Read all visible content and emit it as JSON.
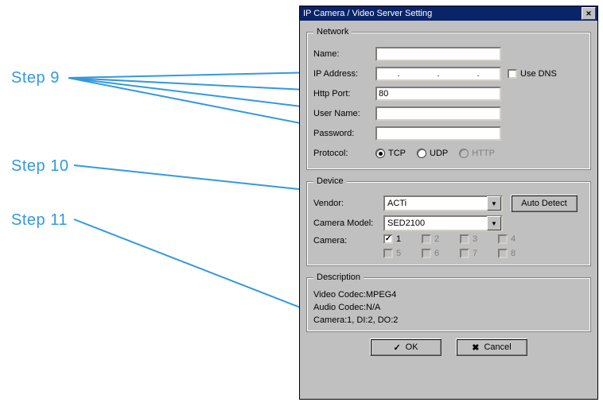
{
  "annotations": {
    "step9": "Step 9",
    "step10": "Step 10",
    "step11": "Step 11",
    "arrow_color": "#3399dd"
  },
  "dialog": {
    "title": "IP Camera / Video Server Setting",
    "close_glyph": "✕"
  },
  "network": {
    "legend": "Network",
    "name_label": "Name:",
    "name_value": "",
    "ip_label": "IP Address:",
    "ip_placeholder": ".       .       .",
    "use_dns_label": "Use DNS",
    "use_dns_checked": false,
    "http_port_label": "Http Port:",
    "http_port_value": "80",
    "user_label": "User Name:",
    "user_value": "",
    "pass_label": "Password:",
    "pass_value": "",
    "protocol_label": "Protocol:",
    "protocol_options": {
      "tcp": "TCP",
      "udp": "UDP",
      "http": "HTTP"
    },
    "protocol_selected": "tcp"
  },
  "device": {
    "legend": "Device",
    "vendor_label": "Vendor:",
    "vendor_value": "ACTi",
    "auto_detect": "Auto Detect",
    "model_label": "Camera Model:",
    "model_value": "SED2100",
    "camera_label": "Camera:",
    "camera_numbers": [
      "1",
      "2",
      "3",
      "4",
      "5",
      "6",
      "7",
      "8"
    ],
    "camera_checked": [
      true,
      false,
      false,
      false,
      false,
      false,
      false,
      false
    ],
    "camera_enabled": [
      true,
      false,
      false,
      false,
      false,
      false,
      false,
      false
    ]
  },
  "description": {
    "legend": "Description",
    "line1": "Video Codec:MPEG4",
    "line2": "Audio Codec:N/A",
    "line3": "Camera:1, DI:2, DO:2"
  },
  "buttons": {
    "ok": "OK",
    "ok_glyph": "✓",
    "cancel": "Cancel",
    "cancel_glyph": "✖"
  }
}
